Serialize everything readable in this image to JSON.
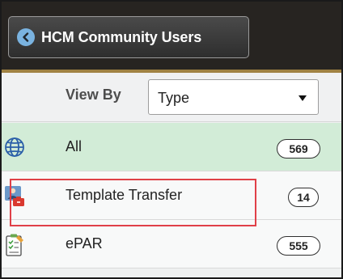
{
  "header": {
    "back_button_label": "HCM Community Users",
    "back_icon": "chevron-left-icon"
  },
  "filter": {
    "view_by_label": "View By",
    "select_value": "Type"
  },
  "list": {
    "items": [
      {
        "label": "All",
        "count": "569",
        "icon": "globe-icon",
        "selected": true
      },
      {
        "label": "Template Transfer",
        "count": "14",
        "icon": "user-transfer-icon",
        "selected": false
      },
      {
        "label": "ePAR",
        "count": "555",
        "icon": "form-checklist-icon",
        "selected": false
      }
    ]
  },
  "colors": {
    "header_bg": "#272421",
    "accent_gold": "#a08243",
    "selected_row": "#d2ecd7",
    "highlight_border": "#e04048"
  }
}
